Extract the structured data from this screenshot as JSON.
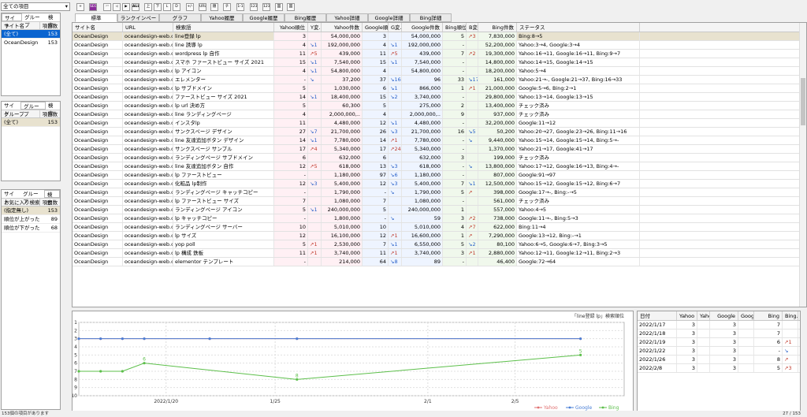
{
  "filter": {
    "value": "全ての項目"
  },
  "toolbar": {
    "all": "ALL",
    "up": "上",
    "down": "下",
    "l": "L",
    "d": "D",
    "diff": "+/-",
    "url": "URL",
    "rank": "順位",
    "chk": "チェック",
    "one": "1-1",
    "c1": "123",
    "c2": "123",
    "c3": "図",
    "c4": "図"
  },
  "pane1": {
    "tabs": [
      "サイト",
      "グループ",
      "検索"
    ],
    "cols": [
      "サイト名",
      "項目数"
    ],
    "rows": [
      [
        "(全て)",
        "153"
      ],
      [
        "OceanDesign",
        "153"
      ]
    ]
  },
  "pane2": {
    "tabs": [
      "サイト",
      "グループ",
      "検索"
    ],
    "cols": [
      "グループ",
      "項目数"
    ],
    "rows": [
      [
        "(全て)",
        "153"
      ]
    ]
  },
  "pane3": {
    "tabs": [
      "サイト",
      "グループ",
      "検索"
    ],
    "cols": [
      "お気に入り検索",
      "項目数"
    ],
    "rows": [
      [
        "(指定無し)",
        "153"
      ],
      [
        "順位が上がった",
        "89"
      ],
      [
        "順位が下がった",
        "68"
      ]
    ]
  },
  "main_tabs": [
    "標準",
    "ランクインページ",
    "グラフ",
    "Yahoo履歴",
    "Google履歴",
    "Bing履歴",
    "Yahoo詳細",
    "Google詳細",
    "Bing詳細"
  ],
  "table": {
    "cols": [
      "サイト名",
      "URL",
      "検索語",
      "Yahoo順位",
      "Y変..",
      "Yahoo件数",
      "Google順位",
      "G変..",
      "Google件数",
      "Bing順位",
      "B変..",
      "Bing件数",
      "ステータス"
    ],
    "rows": [
      [
        "OceanDesign",
        "oceandesign-web.c",
        "line登録 lp",
        "3",
        "",
        "54,000,000",
        "3",
        "",
        "54,000,000",
        "5",
        "↗3",
        "7,830,000",
        "Bing:8→5"
      ],
      [
        "OceanDesign",
        "oceandesign-web.c",
        "line 誘導 lp",
        "4",
        "↘1",
        "192,000,000",
        "4",
        "↘1",
        "192,000,000",
        "-",
        "",
        "52,200,000",
        "Yahoo:3→4, Google:3→4"
      ],
      [
        "OceanDesign",
        "oceandesign-web.c",
        "wordpress lp 自作",
        "11",
        "↗5",
        "439,000",
        "11",
        "↗5",
        "439,000",
        "7",
        "↗2",
        "19,300,000",
        "Yahoo:16→11, Google:16→11, Bing:9→7"
      ],
      [
        "OceanDesign",
        "oceandesign-web.c",
        "スマホ ファーストビュー サイズ 2021",
        "15",
        "↘1",
        "7,540,000",
        "15",
        "↘1",
        "7,540,000",
        "-",
        "",
        "14,800,000",
        "Yahoo:14→15, Google:14→15"
      ],
      [
        "OceanDesign",
        "oceandesign-web.c",
        "lp アイコン",
        "4",
        "↘1",
        "54,800,000",
        "4",
        "",
        "54,800,000",
        "-",
        "",
        "18,200,000",
        "Yahoo:5→4"
      ],
      [
        "OceanDesign",
        "oceandesign-web.c",
        "エレメンター",
        "-",
        "↘",
        "37,200",
        "37",
        "↘16",
        "96",
        "33",
        "↘17",
        "161,000",
        "Yahoo:21→-, Google:21→37, Bing:16→33"
      ],
      [
        "OceanDesign",
        "oceandesign-web.c",
        "lp サブドメイン",
        "5",
        "",
        "1,030,000",
        "6",
        "↘1",
        "866,000",
        "1",
        "↗1",
        "21,000,000",
        "Google:5→6, Bing:2→1"
      ],
      [
        "OceanDesign",
        "oceandesign-web.c",
        "ファーストビュー サイズ 2021",
        "14",
        "↘1",
        "18,400,000",
        "15",
        "↘2",
        "3,740,000",
        "-",
        "",
        "29,800,000",
        "Yahoo:13→14, Google:13→15"
      ],
      [
        "OceanDesign",
        "oceandesign-web.c",
        "lp url 決め方",
        "5",
        "",
        "60,300",
        "5",
        "",
        "275,000",
        "2",
        "",
        "13,400,000",
        "チェック済み"
      ],
      [
        "OceanDesign",
        "oceandesign-web.c",
        "line ランディングページ",
        "4",
        "",
        "2,000,000,..",
        "4",
        "",
        "2,000,000,..",
        "9",
        "",
        "937,000",
        "チェック済み"
      ],
      [
        "OceanDesign",
        "oceandesign-web.c",
        "インスタlp",
        "11",
        "",
        "4,480,000",
        "12",
        "↘1",
        "4,480,000",
        "-",
        "",
        "32,200,000",
        "Google:11→12"
      ],
      [
        "OceanDesign",
        "oceandesign-web.c",
        "サンクスページ デザイン",
        "27",
        "↘7",
        "21,700,000",
        "26",
        "↘3",
        "21,700,000",
        "16",
        "↘5",
        "50,200",
        "Yahoo:20→27, Google:23→26, Bing:11→16"
      ],
      [
        "OceanDesign",
        "oceandesign-web.c",
        "line 友達追加ボタン デザイン",
        "14",
        "↘1",
        "7,780,000",
        "14",
        "↗1",
        "7,780,000",
        "-",
        "↘",
        "9,440,000",
        "Yahoo:15→14, Google:15→14, Bing:5→-"
      ],
      [
        "OceanDesign",
        "oceandesign-web.c",
        "サンクスページ サンプル",
        "17",
        "↗4",
        "5,340,000",
        "17",
        "↗24",
        "5,340,000",
        "-",
        "",
        "1,370,000",
        "Yahoo:21→17, Google:41→17"
      ],
      [
        "OceanDesign",
        "oceandesign-web.c",
        "ランディングページ サブドメイン",
        "6",
        "",
        "632,000",
        "6",
        "",
        "632,000",
        "3",
        "",
        "199,000",
        "チェック済み"
      ],
      [
        "OceanDesign",
        "oceandesign-web.c",
        "line 友達追加ボタン 自作",
        "12",
        "↗5",
        "618,000",
        "13",
        "↘3",
        "618,000",
        "-",
        "↘",
        "13,800,000",
        "Yahoo:17→12, Google:16→13, Bing:4→-"
      ],
      [
        "OceanDesign",
        "oceandesign-web.c",
        "lp ファーストビュー",
        "-",
        "",
        "1,180,000",
        "97",
        "↘6",
        "1,180,000",
        "-",
        "",
        "807,000",
        "Google:91→97"
      ],
      [
        "OceanDesign",
        "oceandesign-web.c",
        "化粧品 lp制作",
        "12",
        "↘3",
        "5,400,000",
        "12",
        "↘3",
        "5,400,000",
        "7",
        "↘1",
        "12,500,000",
        "Yahoo:15→12, Google:15→12, Bing:6→7"
      ],
      [
        "OceanDesign",
        "oceandesign-web.c",
        "ランディングページ キャッチコピー",
        "-",
        "",
        "1,790,000",
        "-",
        "↘",
        "1,790,000",
        "5",
        "↗",
        "398,000",
        "Google:17→-, Bing:-→5"
      ],
      [
        "OceanDesign",
        "oceandesign-web.c",
        "lp ファーストビュー サイズ",
        "7",
        "",
        "1,080,000",
        "7",
        "",
        "1,080,000",
        "-",
        "",
        "561,000",
        "チェック済み"
      ],
      [
        "OceanDesign",
        "oceandesign-web.c",
        "ランディングページ アイコン",
        "5",
        "↘1",
        "240,000,000",
        "5",
        "",
        "240,000,000",
        "1",
        "",
        "557,000",
        "Yahoo:4→5"
      ],
      [
        "OceanDesign",
        "oceandesign-web.c",
        "lp キャッチコピー",
        "-",
        "",
        "1,800,000",
        "-",
        "↘",
        "59",
        "3",
        "↗2",
        "738,000",
        "Google:11→-, Bing:5→3"
      ],
      [
        "OceanDesign",
        "oceandesign-web.c",
        "ランディングページ サーバー",
        "10",
        "",
        "5,010,000",
        "10",
        "",
        "5,010,000",
        "4",
        "↗7",
        "622,000",
        "Bing:11→4"
      ],
      [
        "OceanDesign",
        "oceandesign-web.c",
        "lp サイズ",
        "12",
        "",
        "16,100,000",
        "12",
        "↗1",
        "16,600,000",
        "1",
        "↗",
        "7,290,000",
        "Google:13→12, Bing:-→1"
      ],
      [
        "OceanDesign",
        "oceandesign-web.c",
        "yop poll",
        "5",
        "↗1",
        "2,530,000",
        "7",
        "↘1",
        "6,550,000",
        "5",
        "↘2",
        "80,100",
        "Yahoo:6→5, Google:6→7, Bing:3→5"
      ],
      [
        "OceanDesign",
        "oceandesign-web.c",
        "lp 構成 鉄板",
        "11",
        "↗1",
        "3,740,000",
        "11",
        "↗1",
        "3,740,000",
        "3",
        "↗1",
        "2,880,000",
        "Yahoo:12→11, Google:12→11, Bing:2→3"
      ],
      [
        "OceanDesign",
        "oceandesign-web.c",
        "elementor テンプレート",
        "-",
        "",
        "214,000",
        "64",
        "↘8",
        "89",
        "-",
        "",
        "46,400",
        "Google:72→64"
      ]
    ]
  },
  "chart": {
    "title": "「line登録 lp」検索順位",
    "legend": [
      "Yahoo",
      "Google",
      "Bing"
    ]
  },
  "chart_data": {
    "type": "line",
    "title": "「line登録 lp」検索順位",
    "x_ticks": [
      "2022/1/20",
      "1/25",
      "2/1",
      "2/5"
    ],
    "y_ticks": [
      "1",
      "2",
      "3",
      "4",
      "5",
      "6",
      "7",
      "8",
      "9",
      "10"
    ],
    "ylim": [
      1,
      10
    ],
    "y_inverted": true,
    "series": [
      {
        "name": "Yahoo",
        "color": "#e07070",
        "points": [
          [
            "2022/1/16",
            3
          ],
          [
            "2022/1/17",
            3
          ],
          [
            "2022/1/18",
            3
          ],
          [
            "2022/1/19",
            3
          ],
          [
            "2022/1/22",
            3
          ],
          [
            "2022/1/26",
            3
          ],
          [
            "2022/2/8",
            3
          ]
        ]
      },
      {
        "name": "Google",
        "color": "#4a7fd6",
        "points": [
          [
            "2022/1/16",
            3
          ],
          [
            "2022/1/17",
            3
          ],
          [
            "2022/1/18",
            3
          ],
          [
            "2022/1/19",
            3
          ],
          [
            "2022/1/22",
            3
          ],
          [
            "2022/1/26",
            3
          ],
          [
            "2022/2/8",
            3
          ]
        ]
      },
      {
        "name": "Bing",
        "color": "#5cbf4a",
        "points": [
          [
            "2022/1/16",
            7
          ],
          [
            "2022/1/17",
            7
          ],
          [
            "2022/1/18",
            7
          ],
          [
            "2022/1/19",
            6
          ],
          [
            "2022/1/26",
            8
          ],
          [
            "2022/2/8",
            5
          ]
        ],
        "labels": {
          "2022/1/19": "6",
          "2022/1/26": "8",
          "2022/2/8": "5"
        }
      }
    ]
  },
  "history": {
    "cols": [
      "日付",
      "Yahoo",
      "Yaho..",
      "Google",
      "Goog..",
      "Bing",
      "Bing.."
    ],
    "rows": [
      [
        "2022/1/17",
        "3",
        "",
        "3",
        "",
        "7",
        ""
      ],
      [
        "2022/1/18",
        "3",
        "",
        "3",
        "",
        "7",
        ""
      ],
      [
        "2022/1/19",
        "3",
        "",
        "3",
        "",
        "6",
        "↗1"
      ],
      [
        "2022/1/22",
        "3",
        "",
        "3",
        "",
        "-",
        "↘"
      ],
      [
        "2022/1/26",
        "3",
        "",
        "3",
        "",
        "8",
        "↗"
      ],
      [
        "2022/2/8",
        "3",
        "",
        "3",
        "",
        "5",
        "↗3"
      ]
    ]
  },
  "status": {
    "left": "153個の項目があります",
    "right": "27 / 153"
  },
  "colors": {
    "selected": "#0a64d0",
    "yahoo": "#e07070",
    "google": "#4a7fd6",
    "bing": "#5cbf4a"
  }
}
